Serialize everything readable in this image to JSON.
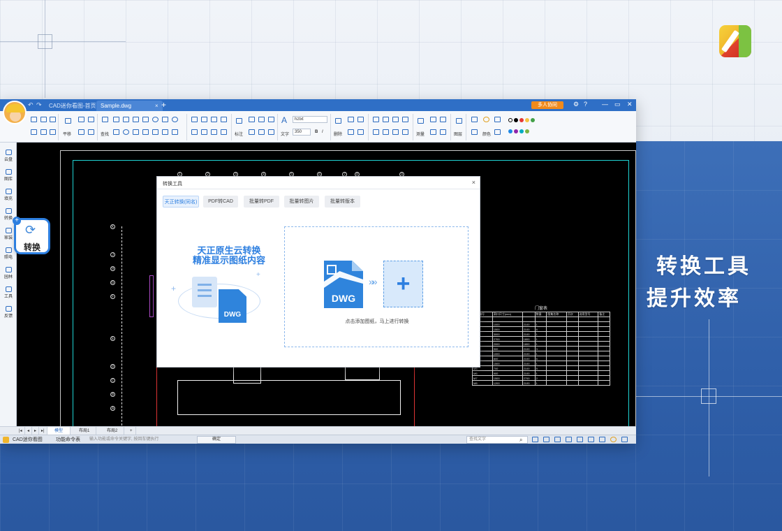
{
  "promo": {
    "line1": "转换工具",
    "line2": "提升效率"
  },
  "titlebar": {
    "tabs": [
      {
        "label": "CAD迷你看图-首页"
      },
      {
        "label": "Sample.dwg",
        "close": "×"
      }
    ],
    "new_tab": "+",
    "collab_button": "多人协同"
  },
  "ribbon": {
    "groups": [
      "平移",
      "查找",
      "标注",
      "文字",
      "删除",
      "测量",
      "图层",
      "颜色"
    ],
    "font_name": "hztxt",
    "font_size": "350",
    "bold": "B",
    "italic": "I",
    "text_tool": "A",
    "palette": [
      "#000000",
      "#e53935",
      "#f6c344",
      "#43a047",
      "#1e88e5",
      "#8e24aa",
      "#00acc1",
      "#7cb342"
    ]
  },
  "sidebar": {
    "items": [
      {
        "label": "云盘",
        "icon": "cloud-icon"
      },
      {
        "label": "图库",
        "icon": "folder-icon"
      },
      {
        "label": "填充",
        "icon": "fill-icon"
      },
      {
        "label": "转换",
        "icon": "convert-icon"
      },
      {
        "label": "家装",
        "icon": "home-icon"
      },
      {
        "label": "照电",
        "icon": "electric-icon"
      },
      {
        "label": "园林",
        "icon": "tree-icon"
      },
      {
        "label": "工具",
        "icon": "tool-icon"
      },
      {
        "label": "反馈",
        "icon": "feedback-icon"
      }
    ]
  },
  "callout": {
    "label": "转换",
    "icon": "convert-icon",
    "badge": "+"
  },
  "dialog": {
    "title": "转换工具",
    "close": "×",
    "tabs": [
      {
        "label": "天正转换(同名)",
        "active": true
      },
      {
        "label": "PDF转CAD",
        "active": false
      },
      {
        "label": "批量转PDF",
        "active": false
      },
      {
        "label": "批量转图片",
        "active": false
      },
      {
        "label": "批量转版本",
        "active": false
      }
    ],
    "headline1": "天正原生云转换",
    "headline2": "精准显示图纸内容",
    "illus_label": "DWG",
    "drop_file_label": "DWG",
    "drop_plus": "+",
    "drop_arrows": "»»",
    "drop_hint": "点击添加图纸，马上进行转换"
  },
  "drawing": {
    "door_table_title": "门窗表",
    "door_table_head": [
      "设计编号",
      "洞口尺寸(mm)",
      "",
      "数量",
      "图集名称",
      "页次",
      "选用型号",
      "备注"
    ],
    "door_table_rows": [
      [
        "",
        "",
        "",
        "",
        "",
        "",
        "",
        ""
      ],
      [
        "",
        "1000",
        "2100",
        "1",
        "",
        "",
        "",
        ""
      ],
      [
        "C1",
        "1500",
        "2100",
        "6",
        "",
        "",
        "",
        ""
      ],
      [
        "C2",
        "3000",
        "2100",
        "1",
        "",
        "",
        "",
        ""
      ],
      [
        "C3",
        "2700",
        "1800",
        "1",
        "",
        "",
        "",
        ""
      ],
      [
        "C4",
        "2000",
        "1800",
        "1",
        "",
        "",
        "",
        ""
      ],
      [
        "M1",
        "900",
        "2100",
        "3",
        "",
        "",
        "",
        ""
      ],
      [
        "M2",
        "1000",
        "2100",
        "1",
        "",
        "",
        "",
        ""
      ],
      [
        "M3",
        "800",
        "2100",
        "6",
        "",
        "",
        "",
        ""
      ],
      [
        "M4",
        "1500",
        "2100",
        "1",
        "",
        "",
        "",
        ""
      ],
      [
        "M5",
        "700",
        "2100",
        "5",
        "",
        "",
        "",
        ""
      ],
      [
        "M6",
        "900",
        "2100",
        "1",
        "",
        "",
        "",
        ""
      ],
      [
        "M7",
        "1500",
        "2700",
        "2",
        "",
        "",
        "",
        ""
      ],
      [
        "M8",
        "1200",
        "2100",
        "1",
        "",
        "",
        "",
        ""
      ]
    ],
    "col_bubbles": [
      "1",
      "2",
      "3",
      "4",
      "5",
      "6",
      "7",
      "8",
      "9"
    ],
    "row_bubbles": [
      "K",
      "J",
      "H",
      "G",
      "F",
      "E",
      "D",
      "C",
      "B",
      "A"
    ]
  },
  "statusbar": {
    "nav": [
      "|◂",
      "◂",
      "▸",
      "▸|"
    ],
    "sheets": [
      "模型",
      "布局1",
      "布局2"
    ],
    "add_sheet": "+"
  },
  "cmdbar": {
    "app_name": "CAD迷你看图",
    "func_table": "功能命令表",
    "prompt": "输入功能或命令关键字, 按回车键执行",
    "confirm": "确定",
    "search": "查找文字"
  }
}
